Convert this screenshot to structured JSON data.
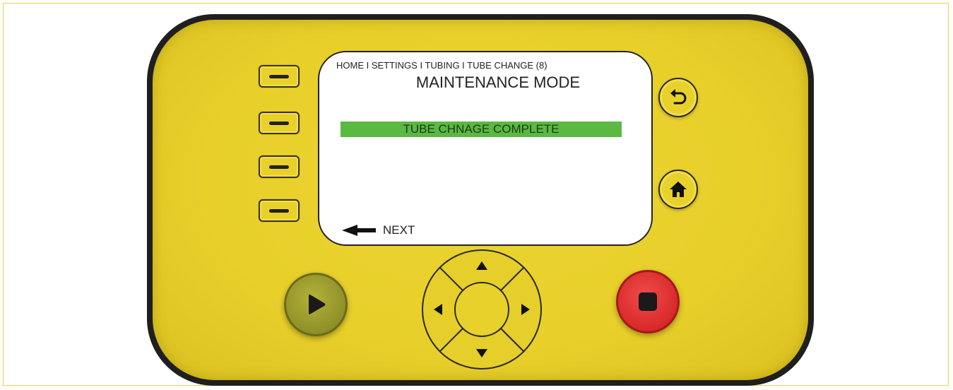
{
  "screen": {
    "breadcrumb": "HOME I SETTINGS I TUBING I TUBE CHANGE (8)",
    "title": "MAINTENANCE MODE",
    "status": "TUBE CHNAGE COMPLETE",
    "next_label": "NEXT"
  },
  "colors": {
    "panel": "#e8cf2a",
    "status_bar": "#5bb843",
    "play_button": "#8f9028",
    "stop_button": "#d82a2a"
  },
  "icons": {
    "back": "back-arrow-icon",
    "home": "home-icon",
    "play": "play-icon",
    "stop": "stop-icon",
    "dpad": [
      "up-arrow-icon",
      "down-arrow-icon",
      "left-arrow-icon",
      "right-arrow-icon"
    ]
  }
}
